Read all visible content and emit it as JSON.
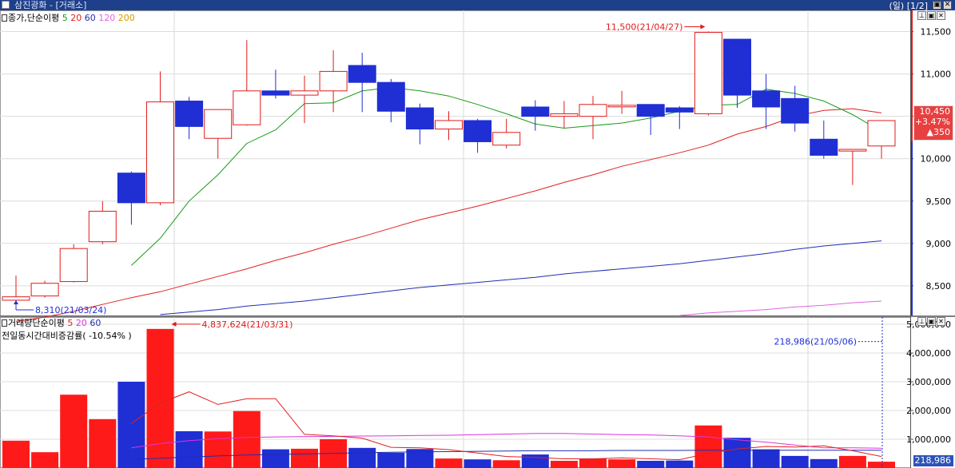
{
  "window": {
    "title": "삼진광화 - [거래소]",
    "right_label": "(일) [1/2]",
    "buttons": [
      "▣",
      "✕"
    ]
  },
  "price_panel": {
    "legend": {
      "title": "종가,단순이평",
      "periods": [
        {
          "label": "5",
          "color": "#1a9a1a"
        },
        {
          "label": "20",
          "color": "#e02020"
        },
        {
          "label": "60",
          "color": "#1e2fb0"
        },
        {
          "label": "120",
          "color": "#dd66dd"
        },
        {
          "label": "200",
          "color": "#d49a00"
        }
      ]
    },
    "current": {
      "price": "10,450",
      "change_pct": "+3.47%",
      "change": "▲350"
    }
  },
  "volume_panel": {
    "legend": {
      "title": "거래량단순이평",
      "periods": [
        {
          "label": "5",
          "color": "#e02020"
        },
        {
          "label": "20",
          "color": "#dd33dd"
        },
        {
          "label": "60",
          "color": "#1e2fb0"
        }
      ],
      "line2": "전일동시간대비증감률( -10.54% )"
    },
    "current": "218,986"
  },
  "chart_data": [
    {
      "type": "candlestick",
      "ylim": [
        8150,
        11750
      ],
      "yticks": [
        8500,
        9000,
        9500,
        10000,
        10500,
        11000,
        11500
      ],
      "ytick_labels": [
        "8,500",
        "9,000",
        "9,500",
        "10,000",
        "10,500",
        "11,000",
        "11,500"
      ],
      "candles": [
        {
          "o": 8330,
          "h": 8620,
          "l": 8310,
          "c": 8370
        },
        {
          "o": 8380,
          "h": 8560,
          "l": 8360,
          "c": 8530
        },
        {
          "o": 8550,
          "h": 8990,
          "l": 8540,
          "c": 8940
        },
        {
          "o": 9020,
          "h": 9500,
          "l": 8990,
          "c": 9380
        },
        {
          "o": 9830,
          "h": 9850,
          "l": 9220,
          "c": 9480
        },
        {
          "o": 9480,
          "h": 11030,
          "l": 9450,
          "c": 10670
        },
        {
          "o": 10680,
          "h": 10730,
          "l": 10230,
          "c": 10380
        },
        {
          "o": 10240,
          "h": 10580,
          "l": 10000,
          "c": 10580
        },
        {
          "o": 10400,
          "h": 11400,
          "l": 10390,
          "c": 10800
        },
        {
          "o": 10800,
          "h": 11050,
          "l": 10710,
          "c": 10750
        },
        {
          "o": 10750,
          "h": 10980,
          "l": 10420,
          "c": 10800
        },
        {
          "o": 10800,
          "h": 11280,
          "l": 10550,
          "c": 11030
        },
        {
          "o": 11100,
          "h": 11250,
          "l": 10550,
          "c": 10900
        },
        {
          "o": 10900,
          "h": 10940,
          "l": 10430,
          "c": 10560
        },
        {
          "o": 10600,
          "h": 10650,
          "l": 10170,
          "c": 10350
        },
        {
          "o": 10350,
          "h": 10560,
          "l": 10220,
          "c": 10450
        },
        {
          "o": 10450,
          "h": 10470,
          "l": 10070,
          "c": 10200
        },
        {
          "o": 10160,
          "h": 10470,
          "l": 10120,
          "c": 10310
        },
        {
          "o": 10610,
          "h": 10690,
          "l": 10330,
          "c": 10500
        },
        {
          "o": 10500,
          "h": 10680,
          "l": 10360,
          "c": 10530
        },
        {
          "o": 10500,
          "h": 10740,
          "l": 10230,
          "c": 10640
        },
        {
          "o": 10620,
          "h": 10800,
          "l": 10530,
          "c": 10630
        },
        {
          "o": 10640,
          "h": 10620,
          "l": 10280,
          "c": 10500
        },
        {
          "o": 10600,
          "h": 10620,
          "l": 10350,
          "c": 10550
        },
        {
          "o": 10530,
          "h": 11500,
          "l": 10510,
          "c": 11490
        },
        {
          "o": 11410,
          "h": 11400,
          "l": 10600,
          "c": 10750
        },
        {
          "o": 10800,
          "h": 11000,
          "l": 10350,
          "c": 10610
        },
        {
          "o": 10710,
          "h": 10860,
          "l": 10320,
          "c": 10420
        },
        {
          "o": 10230,
          "h": 10450,
          "l": 10000,
          "c": 10040
        },
        {
          "o": 10090,
          "h": 10100,
          "l": 9690,
          "c": 10110
        },
        {
          "o": 10150,
          "h": 10450,
          "l": 10000,
          "c": 10450
        }
      ],
      "ma5": [
        null,
        null,
        null,
        null,
        8740,
        9060,
        9500,
        9810,
        10180,
        10340,
        10650,
        10660,
        10800,
        10840,
        10800,
        10740,
        10640,
        10530,
        10410,
        10360,
        10390,
        10420,
        10480,
        10560,
        10630,
        10640,
        10820,
        10770,
        10680,
        10520,
        10320
      ],
      "ma20": [
        8080,
        8130,
        8200,
        8280,
        8360,
        8430,
        8520,
        8610,
        8700,
        8800,
        8890,
        8990,
        9080,
        9180,
        9280,
        9360,
        9440,
        9530,
        9620,
        9720,
        9810,
        9910,
        9990,
        10070,
        10160,
        10290,
        10380,
        10500,
        10570,
        10590,
        10540
      ],
      "ma60": [
        null,
        null,
        null,
        null,
        null,
        8160,
        8190,
        8220,
        8260,
        8290,
        8320,
        8360,
        8400,
        8440,
        8480,
        8510,
        8540,
        8570,
        8600,
        8640,
        8670,
        8700,
        8730,
        8760,
        8800,
        8840,
        8880,
        8930,
        8970,
        9000,
        9030,
        9060,
        9090,
        9120,
        9150
      ],
      "ma120": [
        null,
        null,
        null,
        null,
        null,
        null,
        null,
        null,
        null,
        null,
        null,
        null,
        null,
        null,
        null,
        null,
        null,
        null,
        null,
        null,
        null,
        null,
        null,
        8150,
        8180,
        8200,
        8220,
        8250,
        8270,
        8300,
        8320
      ],
      "annotations": [
        {
          "text": "11,500(21/04/27)",
          "index": 24,
          "value": 11500
        },
        {
          "text": "8,310(21/03/24)",
          "index": 0,
          "value": 8310
        }
      ]
    },
    {
      "type": "bar",
      "ylim": [
        0,
        5250000
      ],
      "yticks": [
        1000000,
        2000000,
        3000000,
        4000000,
        5000000
      ],
      "ytick_labels": [
        "1,000,000",
        "2,000,000",
        "3,000,000",
        "4,000,000",
        "5,000,000"
      ],
      "values": [
        950000,
        550000,
        2550000,
        1700000,
        3000000,
        4837624,
        1280000,
        1270000,
        1980000,
        650000,
        670000,
        1000000,
        700000,
        530000,
        660000,
        330000,
        300000,
        270000,
        470000,
        250000,
        330000,
        300000,
        250000,
        260000,
        1480000,
        1050000,
        650000,
        420000,
        310000,
        420000,
        218986
      ],
      "colors": [
        "up",
        "up",
        "up",
        "up",
        "down",
        "up",
        "down",
        "up",
        "up",
        "down",
        "up",
        "up",
        "down",
        "down",
        "down",
        "up",
        "down",
        "up",
        "down",
        "up",
        "up",
        "up",
        "down",
        "down",
        "up",
        "down",
        "down",
        "down",
        "down",
        "up",
        "up"
      ],
      "ma5": [
        null,
        null,
        null,
        null,
        1550000,
        2260000,
        2650000,
        2210000,
        2410000,
        2410000,
        1170000,
        1120000,
        1040000,
        720000,
        700000,
        640000,
        520000,
        400000,
        370000,
        320000,
        320000,
        350000,
        320000,
        290000,
        510000,
        660000,
        750000,
        730000,
        770000,
        600000,
        400000
      ],
      "ma20": [
        null,
        null,
        null,
        null,
        700000,
        850000,
        950000,
        1020000,
        1060000,
        1080000,
        1090000,
        1100000,
        1110000,
        1120000,
        1130000,
        1140000,
        1160000,
        1180000,
        1200000,
        1200000,
        1180000,
        1160000,
        1150000,
        1120000,
        1080000,
        980000,
        900000,
        800000,
        700000,
        700000,
        690000
      ],
      "ma60": [
        null,
        null,
        null,
        null,
        300000,
        340000,
        380000,
        420000,
        450000,
        470000,
        490000,
        510000,
        530000,
        550000,
        560000,
        570000,
        580000,
        590000,
        600000,
        600000,
        600000,
        610000,
        610000,
        610000,
        620000,
        620000,
        620000,
        620000,
        620000,
        620000,
        620000
      ],
      "annotations": [
        {
          "text": "4,837,624(21/03/31)",
          "index": 5,
          "value": 4837624
        },
        {
          "text": "218,986(21/05/06)",
          "index": 30,
          "value": 218986
        }
      ]
    }
  ]
}
